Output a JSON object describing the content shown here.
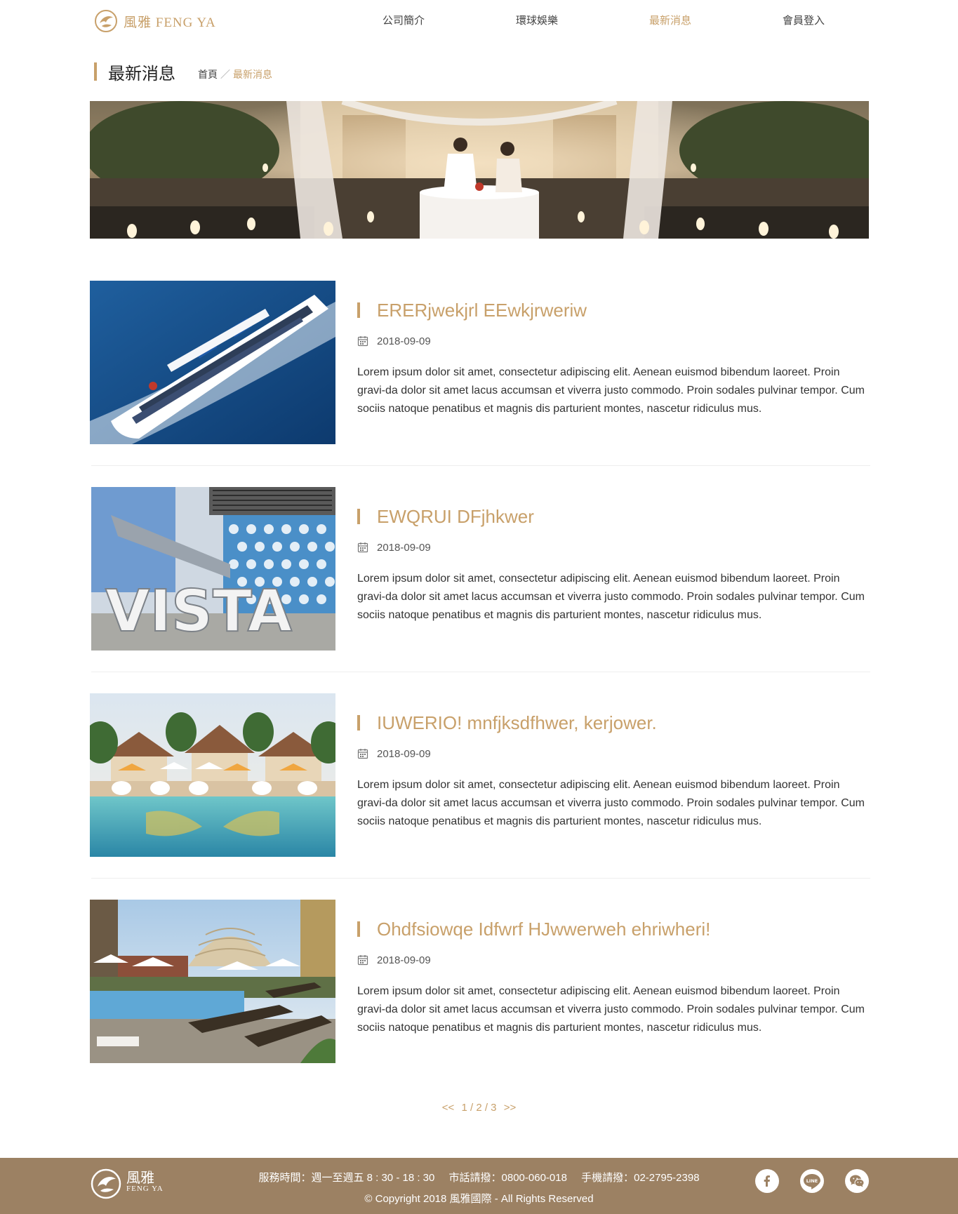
{
  "header": {
    "logo_text": "風雅 FENG YA",
    "nav": [
      {
        "label": "公司簡介",
        "active": false
      },
      {
        "label": "環球娛樂",
        "active": false
      },
      {
        "label": "最新消息",
        "active": true
      },
      {
        "label": "會員登入",
        "active": false
      }
    ]
  },
  "page": {
    "title": "最新消息",
    "breadcrumb": {
      "home": "首頁",
      "separator": "／",
      "current": "最新消息"
    }
  },
  "news": [
    {
      "title": "ERERjwekjrl EEwkjrweriw",
      "date": "2018-09-09",
      "text": "Lorem ipsum dolor sit amet, consectetur adipiscing elit. Aenean euismod bibendum laoreet. Proin gravi-da dolor sit amet lacus accumsan et viverra justo commodo. Proin sodales pulvinar tempor. Cum sociis natoque penatibus et magnis dis parturient montes, nascetur ridiculus mus."
    },
    {
      "title": "EWQRUI DFjhkwer",
      "date": "2018-09-09",
      "text": "Lorem ipsum dolor sit amet, consectetur adipiscing elit. Aenean euismod bibendum laoreet. Proin gravi-da dolor sit amet lacus accumsan et viverra justo commodo. Proin sodales pulvinar tempor. Cum sociis natoque penatibus et magnis dis parturient montes, nascetur ridiculus mus.",
      "thumb_text": "VISTA"
    },
    {
      "title": "IUWERIO! mnfjksdfhwer, kerjower.",
      "date": "2018-09-09",
      "text": "Lorem ipsum dolor sit amet, consectetur adipiscing elit. Aenean euismod bibendum laoreet. Proin gravi-da dolor sit amet lacus accumsan et viverra justo commodo. Proin sodales pulvinar tempor. Cum sociis natoque penatibus et magnis dis parturient montes, nascetur ridiculus mus."
    },
    {
      "title": "Ohdfsiowqe Idfwrf HJwwerweh  ehriwheri!",
      "date": "2018-09-09",
      "text": "Lorem ipsum dolor sit amet, consectetur adipiscing elit. Aenean euismod bibendum laoreet. Proin gravi-da dolor sit amet lacus accumsan et viverra justo commodo. Proin sodales pulvinar tempor. Cum sociis natoque penatibus et magnis dis parturient montes, nascetur ridiculus mus."
    }
  ],
  "pagination": {
    "prev": "<<",
    "pages": "1 / 2 / 3",
    "next": ">>"
  },
  "footer": {
    "logo_big": "風雅",
    "logo_small": "FENG YA",
    "hours": "服務時間：週一至週五 8 : 30 - 18 : 30",
    "phone": "市話請撥：0800-060-018",
    "mobile": "手機請撥：02-2795-2398",
    "copyright": "© Copyright 2018 風雅國際 - All Rights Reserved",
    "social": [
      "facebook-icon",
      "line-icon",
      "wechat-icon"
    ],
    "social_line_label": "LINE"
  },
  "colors": {
    "accent": "#c8a06a",
    "footer_bg": "#9c8163"
  }
}
